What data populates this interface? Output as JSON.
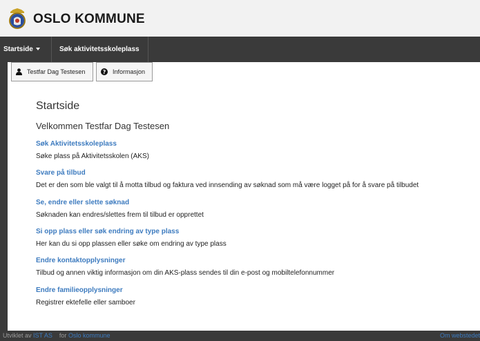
{
  "header": {
    "brand": "OSLO KOMMUNE"
  },
  "nav": {
    "startside": "Startside",
    "sok": "Søk aktivitetsskoleplass"
  },
  "toolbar": {
    "user": "Testfar Dag Testesen",
    "info": "Informasjon"
  },
  "main": {
    "title": "Startside",
    "welcome": "Velkommen Testfar Dag Testesen",
    "sections": [
      {
        "link": "Søk Aktivitetsskoleplass",
        "desc": "Søke plass på Aktivitetsskolen (AKS)"
      },
      {
        "link": "Svare på tilbud",
        "desc": "Det er den som ble valgt til å motta tilbud og faktura ved innsending av søknad som må være logget på for å svare på tilbudet"
      },
      {
        "link": "Se, endre eller slette søknad",
        "desc": "Søknaden kan endres/slettes frem til tilbud er opprettet"
      },
      {
        "link": "Si opp plass eller søk endring av type plass",
        "desc": "Her kan du si opp plassen eller søke om endring av type plass"
      },
      {
        "link": "Endre kontaktopplysninger",
        "desc": "Tilbud og annen viktig informasjon om din AKS-plass sendes til din e-post og mobiltelefonnummer"
      },
      {
        "link": "Endre familieopplysninger",
        "desc": "Registrer ektefelle eller samboer"
      }
    ]
  },
  "footer": {
    "developed_by": "Utviklet av",
    "developer": "IST AS",
    "for_text": "for",
    "client": "Oslo kommune",
    "about": "Om webstedet"
  },
  "colors": {
    "link": "#3d7bbf",
    "nav_bg": "#3a3a3a",
    "header_bg": "#f2f2f2"
  }
}
